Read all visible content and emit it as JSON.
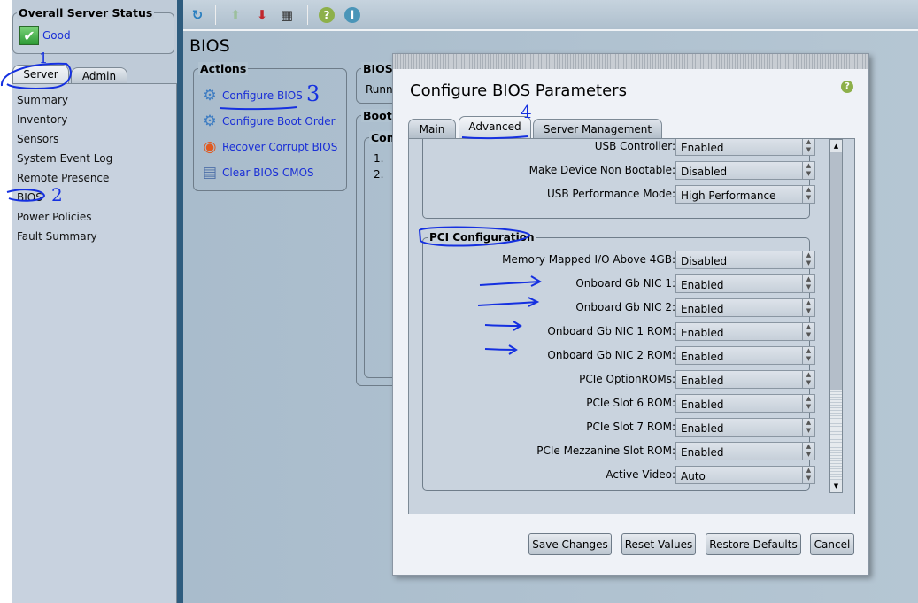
{
  "sidebar": {
    "status_title": "Overall Server Status",
    "status_value": "Good",
    "tabs": [
      "Server",
      "Admin"
    ],
    "items": [
      "Summary",
      "Inventory",
      "Sensors",
      "System Event Log",
      "Remote Presence",
      "BIOS",
      "Power Policies",
      "Fault Summary"
    ]
  },
  "toolbar": {
    "icons": [
      "refresh-icon",
      "upload-icon",
      "download-icon",
      "keyboard-icon",
      "help-icon",
      "info-icon"
    ]
  },
  "main": {
    "title": "BIOS",
    "actions_title": "Actions",
    "actions": [
      "Configure BIOS",
      "Configure Boot Order",
      "Recover Corrupt BIOS",
      "Clear BIOS CMOS"
    ],
    "bios_box_title": "BIOS",
    "bios_box_text": "Runn",
    "boot_box_title": "Boot",
    "boot_inner_title": "Con",
    "boot_list": [
      "1.",
      "2."
    ]
  },
  "dialog": {
    "title": "Configure BIOS Parameters",
    "tabs": [
      "Main",
      "Advanced",
      "Server Management"
    ],
    "active_tab": "Advanced",
    "usb_rows": [
      {
        "label": "USB Controller:",
        "value": "Enabled"
      },
      {
        "label": "Make Device Non Bootable:",
        "value": "Disabled"
      },
      {
        "label": "USB Performance Mode:",
        "value": "High Performance"
      }
    ],
    "pci_title": "PCI Configuration",
    "pci_rows": [
      {
        "label": "Memory Mapped I/O Above 4GB:",
        "value": "Disabled"
      },
      {
        "label": "Onboard Gb NIC 1:",
        "value": "Enabled"
      },
      {
        "label": "Onboard Gb NIC 2:",
        "value": "Enabled"
      },
      {
        "label": "Onboard Gb NIC 1 ROM:",
        "value": "Enabled"
      },
      {
        "label": "Onboard Gb NIC 2 ROM:",
        "value": "Enabled"
      },
      {
        "label": "PCIe OptionROMs:",
        "value": "Enabled"
      },
      {
        "label": "PCIe Slot 6 ROM:",
        "value": "Enabled"
      },
      {
        "label": "PCIe Slot 7 ROM:",
        "value": "Enabled"
      },
      {
        "label": "PCIe Mezzanine Slot ROM:",
        "value": "Enabled"
      },
      {
        "label": "Active Video:",
        "value": "Auto"
      }
    ],
    "buttons": [
      "Save Changes",
      "Reset Values",
      "Restore Defaults",
      "Cancel"
    ]
  },
  "annotations": [
    "1",
    "2",
    "3",
    "4"
  ],
  "colors": {
    "link": "#1a2fd6",
    "annotation": "#1530e0",
    "status_good": "#3cb043"
  }
}
